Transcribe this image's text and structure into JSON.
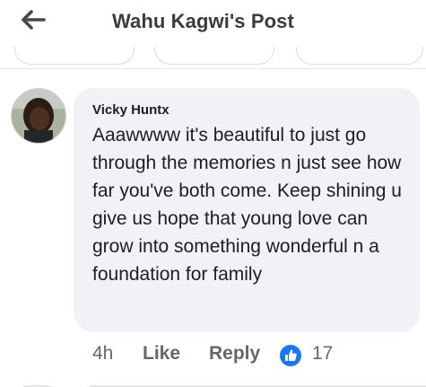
{
  "header": {
    "title": "Wahu Kagwi's Post",
    "back_icon": "arrow-left-icon"
  },
  "comment": {
    "author": "Vicky Huntx",
    "text": "Aaawwww it's beautiful to just go through the memories n just see how far you've both come. Keep shining u give us hope that young love can grow into something wonderful n a foundation for family",
    "time": "4h",
    "like_label": "Like",
    "reply_label": "Reply",
    "reaction_icon": "thumbs-up-icon",
    "reaction_count": "17"
  },
  "colors": {
    "header_text": "#3a3b3c",
    "bubble_bg": "#f0f2f5",
    "meta_text": "#65676b",
    "like_blue": "#1877f2"
  }
}
